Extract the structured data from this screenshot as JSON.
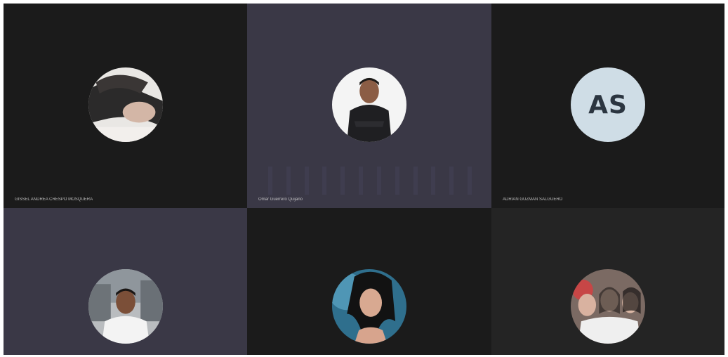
{
  "participants": [
    {
      "name": "GISSEL ANDREA CRESPO MOSQUERA",
      "avatar_icon": "profile-photo-icon",
      "tile_color": "#1b1b1b"
    },
    {
      "name": "Omar Guerrero Quijano",
      "avatar_icon": "profile-photo-icon",
      "tile_color": "#3a3846"
    },
    {
      "name": "ADRIAN GUZMAN SALGUERO",
      "avatar_icon": "initials-avatar",
      "initials": "AS",
      "tile_color": "#1b1b1b"
    },
    {
      "name": "",
      "avatar_icon": "profile-photo-icon",
      "tile_color": "#3a3846"
    },
    {
      "name": "",
      "avatar_icon": "profile-photo-icon",
      "tile_color": "#1b1b1b"
    },
    {
      "name": "",
      "avatar_icon": "profile-photo-icon",
      "tile_color": "#242424"
    }
  ]
}
